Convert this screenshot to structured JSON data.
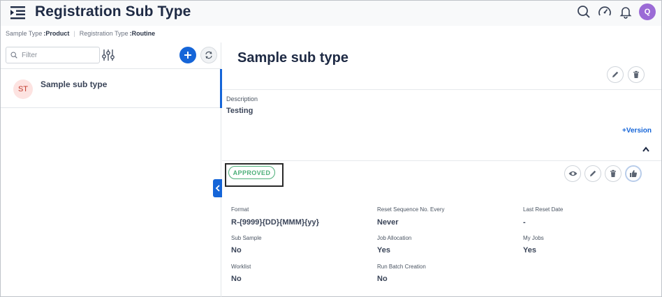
{
  "header": {
    "title": "Registration Sub Type",
    "avatar_initial": "Q"
  },
  "breadcrumb": {
    "sample_type_label": "Sample Type",
    "sample_type_value": ":Product",
    "separator": "|",
    "registration_type_label": "Registration Type",
    "registration_type_value": ":Routine"
  },
  "filter": {
    "placeholder": "Filter"
  },
  "list": {
    "items": [
      {
        "initials": "ST",
        "label": "Sample sub type"
      }
    ]
  },
  "detail": {
    "title": "Sample sub type",
    "description_label": "Description",
    "description_value": "Testing",
    "version_link": "+Version",
    "status": "APPROVED"
  },
  "fields": {
    "format_label": "Format",
    "format_value": "R-{9999}{DD}{MMM}{yy}",
    "reset_label": "Reset Sequence No. Every",
    "reset_value": "Never",
    "last_reset_label": "Last Reset Date",
    "last_reset_value": "-",
    "sub_sample_label": "Sub Sample",
    "sub_sample_value": "No",
    "job_allocation_label": "Job Allocation",
    "job_allocation_value": "Yes",
    "my_jobs_label": "My Jobs",
    "my_jobs_value": "Yes",
    "worklist_label": "Worklist",
    "worklist_value": "No",
    "run_batch_label": "Run Batch Creation",
    "run_batch_value": "No"
  },
  "colors": {
    "accent": "#1565d8",
    "approved": "#4caf78",
    "avatar": "#9b6bd6"
  }
}
